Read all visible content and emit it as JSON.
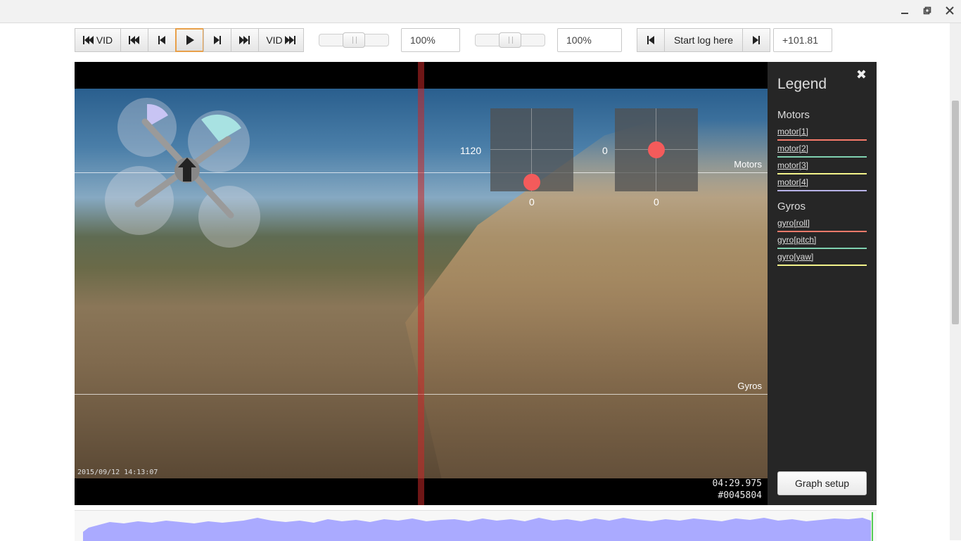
{
  "window": {
    "minimize_icon": "minimize-icon",
    "maximize_icon": "restore-icon",
    "close_icon": "close-icon"
  },
  "toolbar": {
    "vid_start_label": "VID",
    "vid_end_label": "VID",
    "video_rate": "100%",
    "graph_zoom": "100%",
    "start_log_label": "Start log here",
    "offset": "+101.81",
    "video_rate_slider_level": 0.5,
    "graph_zoom_slider_level": 0.5
  },
  "video": {
    "timestamp": "2015/09/12 14:13:07",
    "time": "04:29.975",
    "frame": "#0045804",
    "left_stick": {
      "label": "1120",
      "value": "0"
    },
    "right_stick": {
      "label": "0",
      "value": "0"
    }
  },
  "graphs": {
    "motors_label": "Motors",
    "gyros_label": "Gyros"
  },
  "legend": {
    "title": "Legend",
    "close_icon": "close-icon",
    "groups": [
      {
        "name": "Motors",
        "items": [
          {
            "label": "motor[1]",
            "color": "#f47a6a"
          },
          {
            "label": "motor[2]",
            "color": "#7fd1b0"
          },
          {
            "label": "motor[3]",
            "color": "#f3f38a"
          },
          {
            "label": "motor[4]",
            "color": "#b8b4e8"
          }
        ]
      },
      {
        "name": "Gyros",
        "items": [
          {
            "label": "gyro[roll]",
            "color": "#f47a6a"
          },
          {
            "label": "gyro[pitch]",
            "color": "#7fd1b0"
          },
          {
            "label": "gyro[yaw]",
            "color": "#f3f38a"
          }
        ]
      }
    ],
    "graph_setup_label": "Graph setup"
  },
  "colors": {
    "accent": "#e8a04a",
    "stick_dot": "#f45b5b",
    "timeline_fill": "#aaaaff",
    "timeline_marker": "#55cc55"
  }
}
